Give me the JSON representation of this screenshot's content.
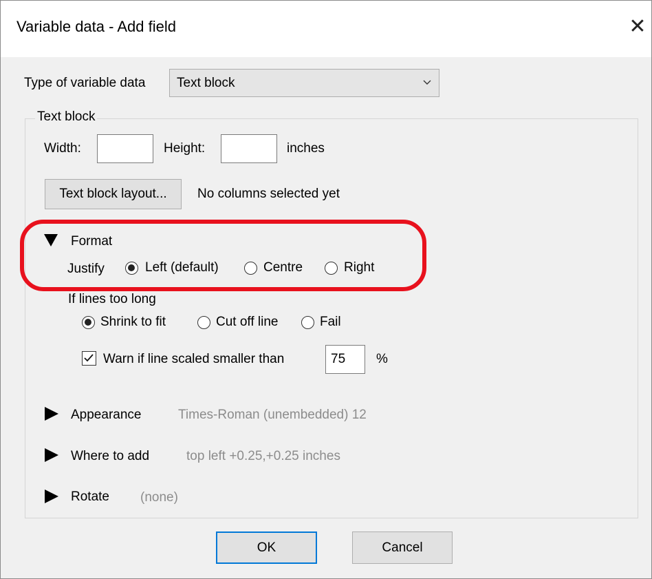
{
  "window": {
    "title": "Variable data - Add field",
    "close_glyph": "✕"
  },
  "type_row": {
    "label": "Type of variable data",
    "selected": "Text block"
  },
  "text_block": {
    "group_label": "Text block",
    "width_label": "Width:",
    "width_value": "",
    "height_label": "Height:",
    "height_value": "",
    "units": "inches",
    "layout_button": "Text block layout...",
    "layout_status": "No columns selected yet"
  },
  "format": {
    "title": "Format",
    "justify_label": "Justify",
    "justify_options": [
      "Left (default)",
      "Centre",
      "Right"
    ],
    "justify_selected": "Left (default)",
    "lines_label": "If lines too long",
    "lines_options": [
      "Shrink to fit",
      "Cut off line",
      "Fail"
    ],
    "lines_selected": "Shrink to fit",
    "warn_label": "Warn if line scaled smaller than",
    "warn_checked": true,
    "warn_value": "75",
    "warn_unit": "%"
  },
  "appearance": {
    "title": "Appearance",
    "summary": "Times-Roman (unembedded) 12"
  },
  "where": {
    "title": "Where to add",
    "summary": "top left +0.25,+0.25 inches"
  },
  "rotate": {
    "title": "Rotate",
    "summary": "(none)"
  },
  "buttons": {
    "ok": "OK",
    "cancel": "Cancel"
  },
  "colors": {
    "highlight": "#e8111d",
    "default_button_border": "#0078d7",
    "summary_text": "#8c8c8c"
  }
}
